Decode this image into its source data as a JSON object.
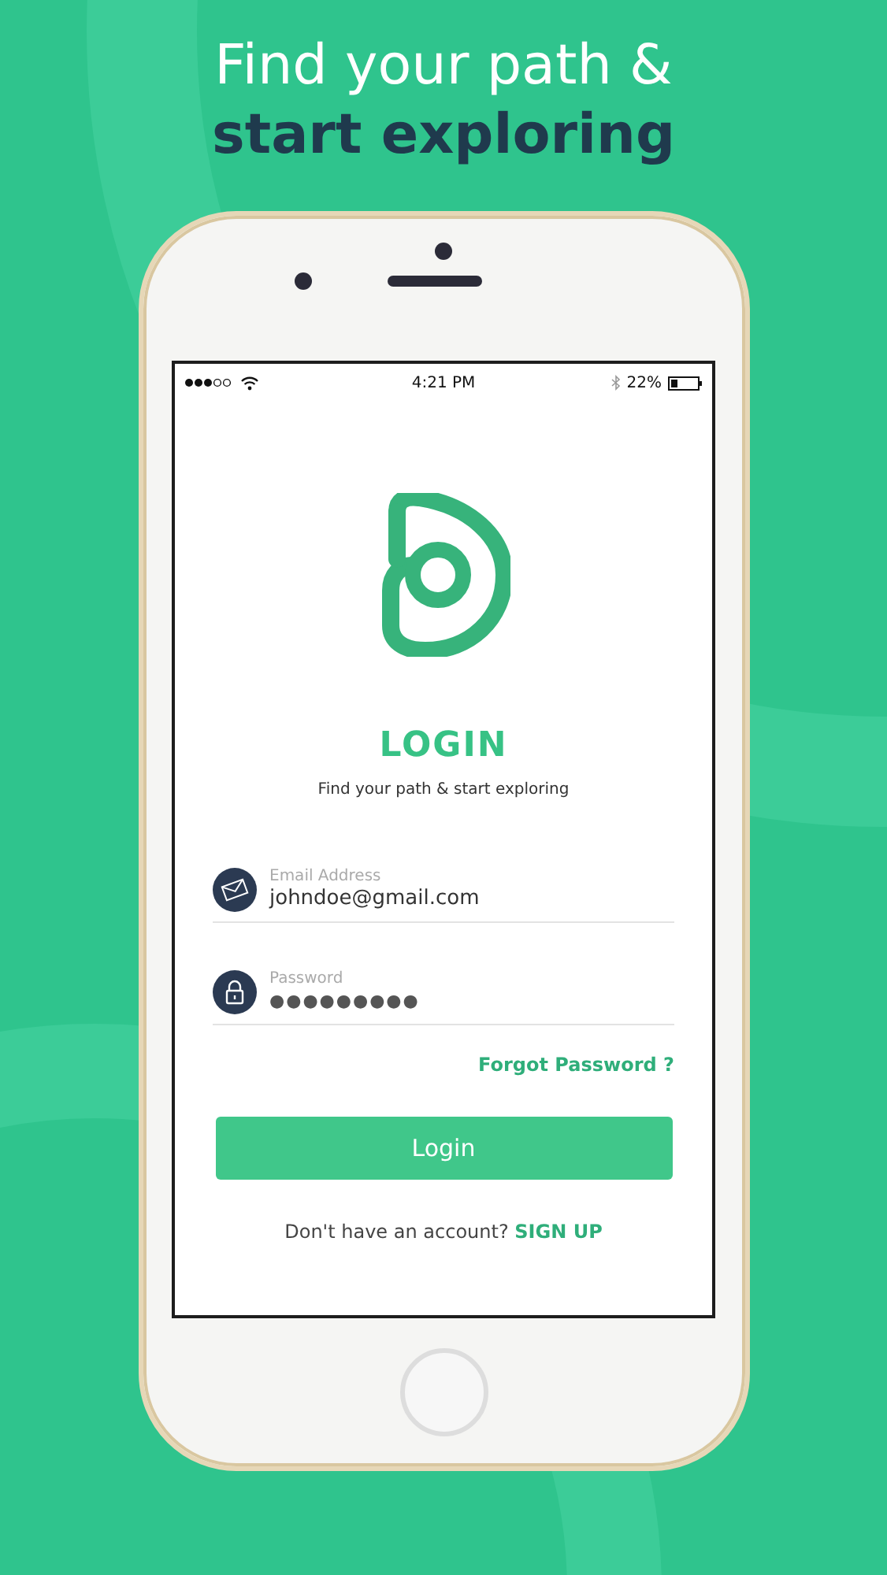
{
  "headline": {
    "line_1": "Find your path &",
    "line_2": "start exploring"
  },
  "status_bar": {
    "time": "4:21 PM",
    "battery": "22%"
  },
  "login": {
    "title": "LOGIN",
    "subtitle": "Find your path & start exploring",
    "fields": [
      {
        "kind": "email",
        "label": "Email Address",
        "value": "johndoe@gmail.com"
      },
      {
        "kind": "password",
        "label": "Password",
        "value": "●●●●●●●●●"
      }
    ],
    "forgot_link": "Forgot Password ?",
    "button": "Login",
    "signup_prompt": "Don't have an account?",
    "signup_link": "SIGN UP"
  }
}
